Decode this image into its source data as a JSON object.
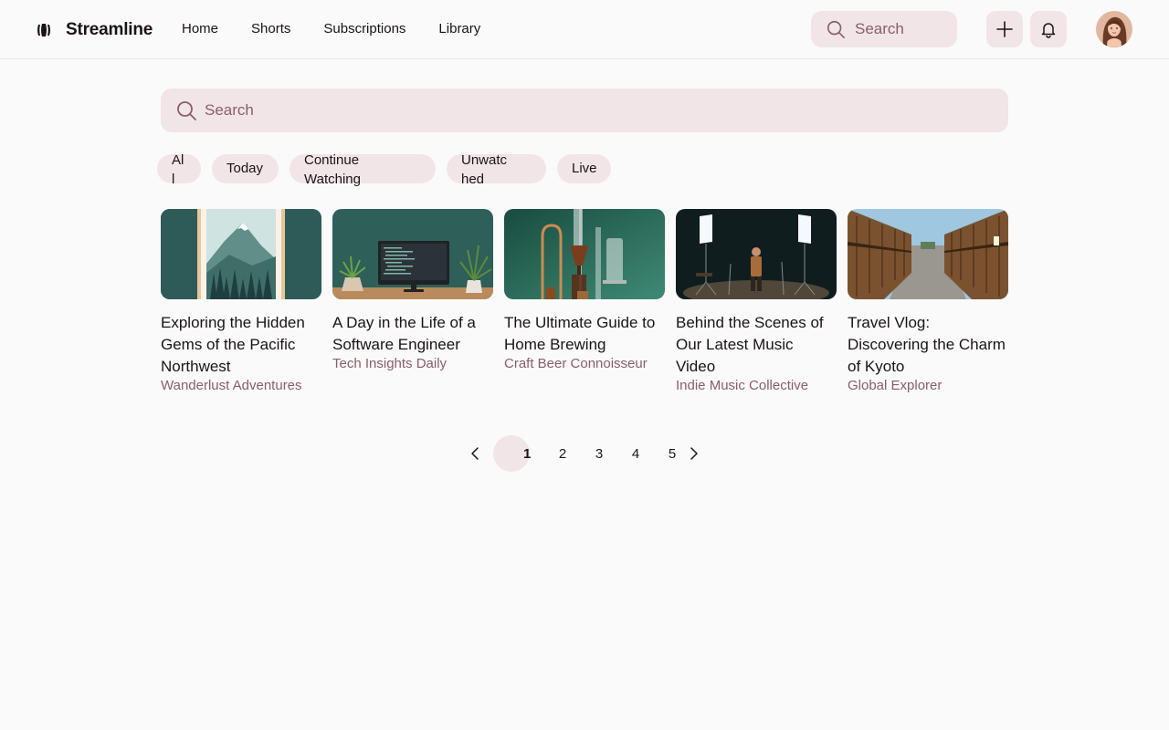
{
  "app": {
    "name": "Streamline"
  },
  "nav": {
    "items": [
      "Home",
      "Shorts",
      "Subscriptions",
      "Library"
    ]
  },
  "header": {
    "search_placeholder": "Search",
    "create_icon": "plus-icon",
    "notifications_icon": "bell-icon"
  },
  "main_search": {
    "placeholder": "Search"
  },
  "filters": [
    {
      "label": "All"
    },
    {
      "label": "Today"
    },
    {
      "label": "Continue Watching"
    },
    {
      "label": "Unwatched"
    },
    {
      "label": "Live"
    }
  ],
  "videos": [
    {
      "title": "Exploring the Hidden Gems of the Pacific Northwest",
      "channel": "Wanderlust Adventures"
    },
    {
      "title": "A Day in the Life of a Software Engineer",
      "channel": "Tech Insights Daily"
    },
    {
      "title": "The Ultimate Guide to Home Brewing",
      "channel": "Craft Beer Connoisseur"
    },
    {
      "title": "Behind the Scenes of Our Latest Music Video",
      "channel": "Indie Music Collective"
    },
    {
      "title": "Travel Vlog: Discovering the Charm of Kyoto",
      "channel": "Global Explorer"
    }
  ],
  "pagination": {
    "pages": [
      "1",
      "2",
      "3",
      "4",
      "5"
    ],
    "current": "1"
  },
  "colors": {
    "accent_bg": "#f1e5e8",
    "muted_text": "#8a5f68",
    "text": "#1b1416",
    "page_bg": "#fafafa"
  }
}
